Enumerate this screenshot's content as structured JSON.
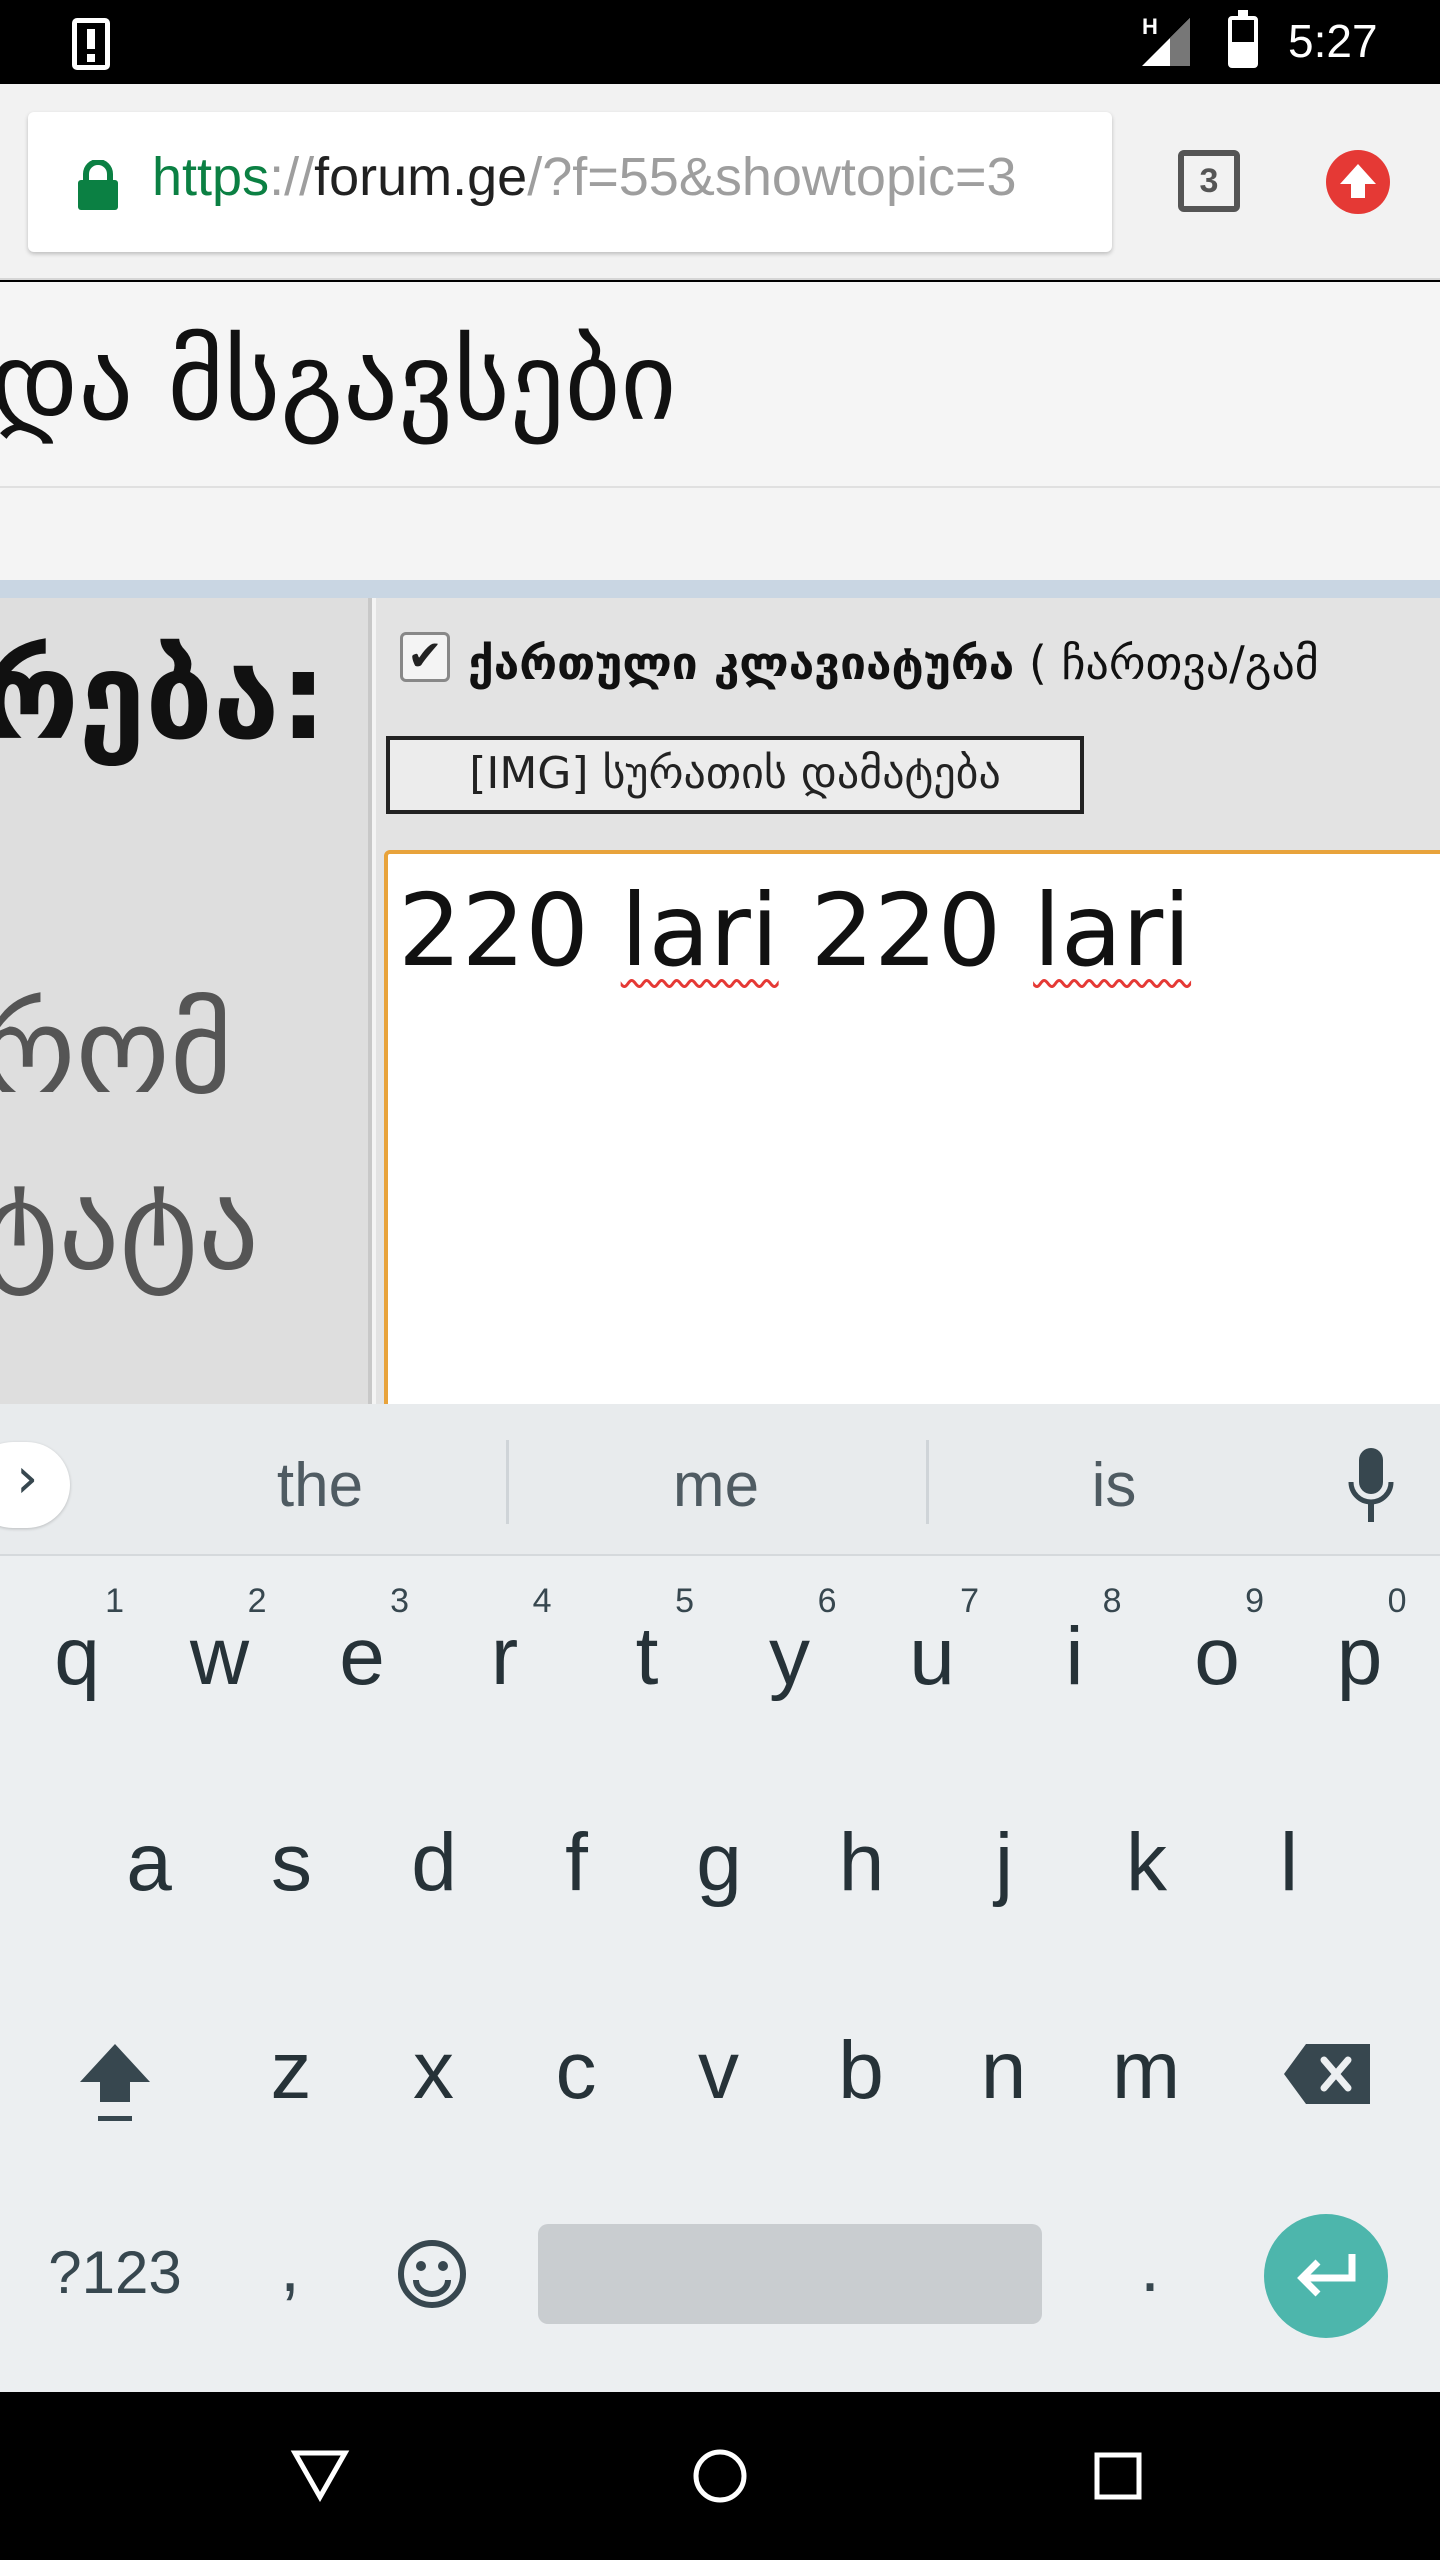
{
  "status_bar": {
    "time": "5:27",
    "network_label": "H",
    "icons": [
      "alert-icon",
      "signal-icon",
      "battery-icon"
    ]
  },
  "browser": {
    "url_scheme": "https",
    "url_separator": "://",
    "url_host": "forum.ge",
    "url_path": "/?f=55&showtopic=3",
    "tab_count": "3",
    "icons": [
      "lock-icon",
      "tabs-icon",
      "update-icon"
    ]
  },
  "page": {
    "title_fragment": "და მსგავსები",
    "left_label": "რება:",
    "left_faint_1": "რომ",
    "left_faint_2": "ტატა",
    "keyboard_toggle": {
      "checked": true,
      "check_glyph": "✔",
      "bold_label": "ქართული კლავიატურა",
      "extra_label": " ( ჩართვა/გამ"
    },
    "img_button_label": "[IMG] სურათის დამატება",
    "editor": {
      "word_1": "220",
      "word_2": "lari",
      "word_3": "220",
      "word_4": "lari"
    }
  },
  "keyboard": {
    "suggestions": [
      "the",
      "me",
      "is"
    ],
    "row1": [
      {
        "ch": "q",
        "hint": "1"
      },
      {
        "ch": "w",
        "hint": "2"
      },
      {
        "ch": "e",
        "hint": "3"
      },
      {
        "ch": "r",
        "hint": "4"
      },
      {
        "ch": "t",
        "hint": "5"
      },
      {
        "ch": "y",
        "hint": "6"
      },
      {
        "ch": "u",
        "hint": "7"
      },
      {
        "ch": "i",
        "hint": "8"
      },
      {
        "ch": "o",
        "hint": "9"
      },
      {
        "ch": "p",
        "hint": "0"
      }
    ],
    "row2": [
      "a",
      "s",
      "d",
      "f",
      "g",
      "h",
      "j",
      "k",
      "l"
    ],
    "row3": [
      "z",
      "x",
      "c",
      "v",
      "b",
      "n",
      "m"
    ],
    "symbols_label": "?123",
    "comma_label": ",",
    "period_label": ".",
    "icons": [
      "chevron-right-icon",
      "microphone-icon",
      "shift-icon",
      "backspace-icon",
      "emoji-icon",
      "enter-icon"
    ]
  },
  "nav_bar": {
    "icons": [
      "back-icon",
      "home-icon",
      "recents-icon"
    ]
  },
  "colors": {
    "url_green": "#0b8043",
    "textarea_focus": "#e8a33b",
    "enter_key": "#4db6ac",
    "update_red": "#e53935",
    "spell_error": "#e53935"
  }
}
